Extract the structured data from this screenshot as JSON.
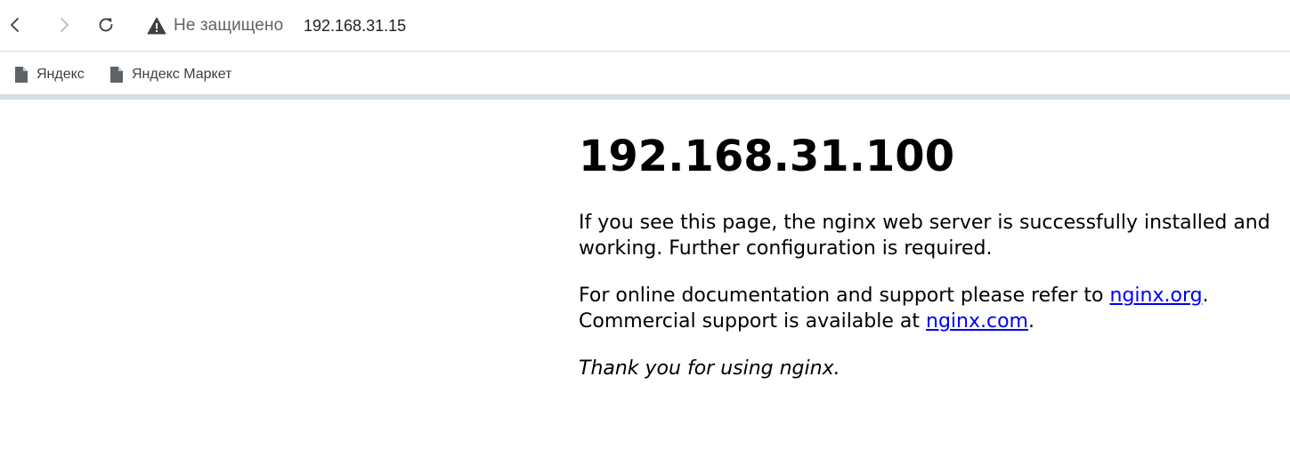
{
  "browser": {
    "security_label": "Не защищено",
    "url": "192.168.31.15",
    "icons": {
      "back": "chevron-left-icon",
      "forward": "chevron-right-icon",
      "reload": "reload-icon",
      "security": "warning-triangle-icon",
      "bookmark": "page-icon"
    }
  },
  "bookmarks": [
    {
      "label": "Яндекс"
    },
    {
      "label": "Яндекс Маркет"
    }
  ],
  "page": {
    "title": "192.168.31.100",
    "para1": {
      "line1": "If you see this page, the nginx web server is successfully installed and",
      "line2": "working. Further configuration is required."
    },
    "para2": {
      "line1_text": "For online documentation and support please refer to ",
      "link1": "nginx.org",
      "line1_end": ".",
      "line2_text": "Commercial support is available at ",
      "link2": "nginx.com",
      "line2_end": "."
    },
    "para3": "Thank you for using nginx."
  },
  "colors": {
    "link": "#0000ee",
    "chrome_divider": "#d6dde3",
    "chrome_text": "#5f6368"
  }
}
